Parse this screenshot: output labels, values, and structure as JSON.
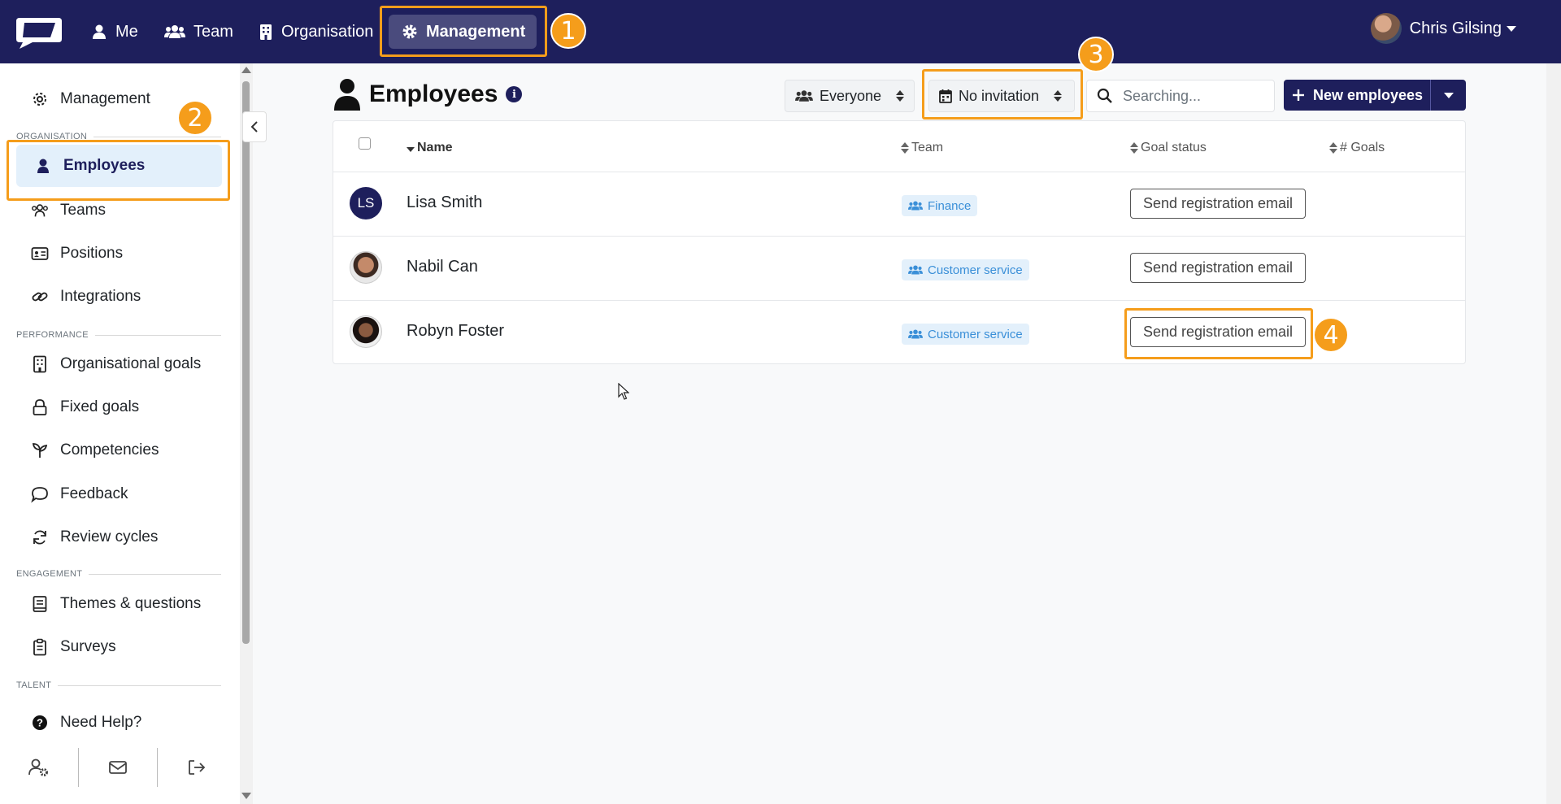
{
  "nav": {
    "items": [
      {
        "label": "Me",
        "icon": "user-icon"
      },
      {
        "label": "Team",
        "icon": "users-icon"
      },
      {
        "label": "Organisation",
        "icon": "building-icon"
      },
      {
        "label": "Management",
        "icon": "gear-icon"
      }
    ],
    "active": "Management",
    "user_name": "Chris Gilsing"
  },
  "sidebar": {
    "top_item": "Management",
    "sections": {
      "organisation": "ORGANISATION",
      "performance": "PERFORMANCE",
      "engagement": "ENGAGEMENT",
      "talent": "TALENT"
    },
    "items": {
      "employees": "Employees",
      "teams": "Teams",
      "positions": "Positions",
      "integrations": "Integrations",
      "org_goals": "Organisational goals",
      "fixed_goals": "Fixed goals",
      "competencies": "Competencies",
      "feedback": "Feedback",
      "review_cycles": "Review cycles",
      "themes": "Themes & questions",
      "surveys": "Surveys",
      "help": "Need Help?"
    }
  },
  "main": {
    "title": "Employees",
    "filter_everyone": "Everyone",
    "filter_invitation": "No invitation",
    "search_placeholder": "Searching...",
    "new_button": "New employees",
    "columns": {
      "name": "Name",
      "team": "Team",
      "goal_status": "Goal status",
      "goals": "# Goals"
    },
    "rows": [
      {
        "initials": "LS",
        "name": "Lisa Smith",
        "team": "Finance",
        "action": "Send registration email"
      },
      {
        "initials": "",
        "name": "Nabil Can",
        "team": "Customer service",
        "action": "Send registration email"
      },
      {
        "initials": "",
        "name": "Robyn Foster",
        "team": "Customer service",
        "action": "Send registration email"
      }
    ]
  },
  "annotations": [
    "1",
    "2",
    "3",
    "4"
  ],
  "colors": {
    "navbar": "#1e1f5c",
    "highlight": "#f59d1b",
    "badge_bg": "#e3f0fb",
    "badge_text": "#3a8fd8"
  }
}
